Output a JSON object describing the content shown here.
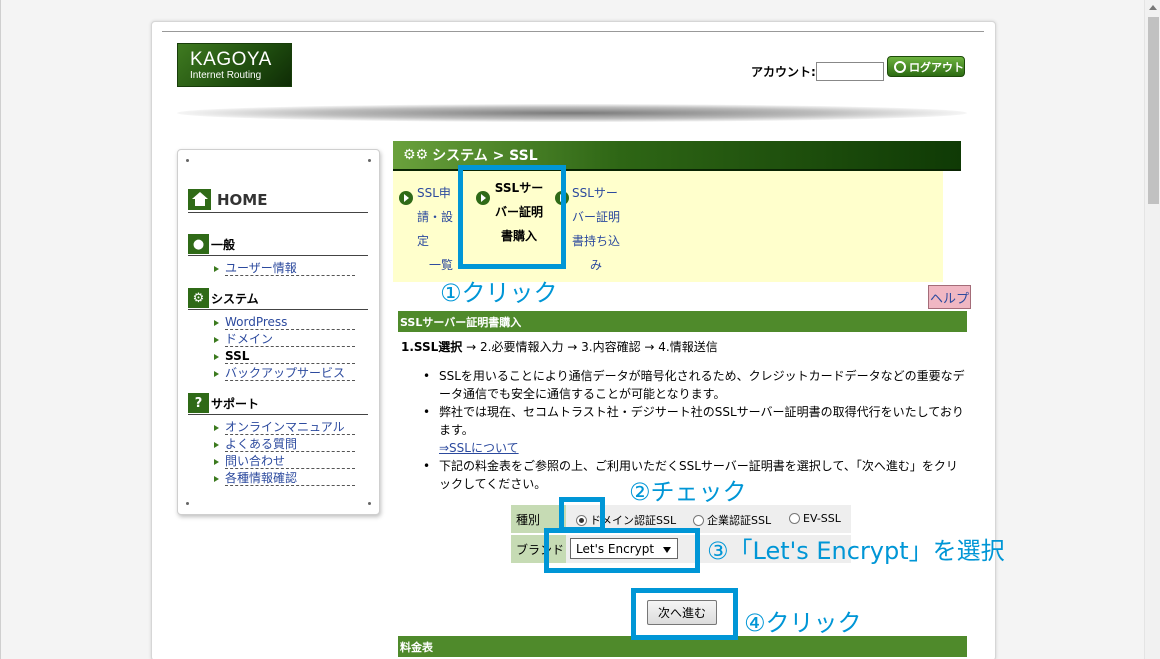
{
  "header": {
    "logo_main": "KAGOYA",
    "logo_sub": "Internet Routing",
    "account_label": "アカウント:",
    "account_value": "",
    "login_label": "ログアウト"
  },
  "sidebar": {
    "home_label": "HOME",
    "sections": [
      {
        "title": "一般",
        "icon": "user-icon",
        "items": [
          "ユーザー情報"
        ]
      },
      {
        "title": "システム",
        "icon": "gear-icon",
        "items": [
          "WordPress",
          "ドメイン",
          "SSL",
          "バックアップサービス"
        ]
      },
      {
        "title": "サポート",
        "icon": "question-icon",
        "items": [
          "オンラインマニュアル",
          "よくある質問",
          "問い合わせ",
          "各種情報確認"
        ]
      }
    ],
    "active_item": "SSL"
  },
  "main": {
    "title": "システム > SSL",
    "tabs": [
      {
        "lines": [
          "SSL申",
          "請・設定",
          "一覧"
        ]
      },
      {
        "lines": [
          "SSLサー",
          "バー証明",
          "書購入"
        ]
      },
      {
        "lines": [
          "SSLサー",
          "バー証明",
          "書持ち込",
          "み"
        ]
      }
    ],
    "help_label": "ヘルプ",
    "section_title": "SSLサーバー証明書購入",
    "steps": {
      "current": "1.SSL選択",
      "rest": " → 2.必要情報入力 → 3.内容確認 → 4.情報送信"
    },
    "bullets": {
      "b1": "SSLを用いることにより通信データが暗号化されるため、クレジットカードデータなどの重要なデータ通信でも安全に通信することが可能となります。",
      "b2": "弊社では現在、セコムトラスト社・デジサート社のSSLサーバー証明書の取得代行をいたしております。",
      "b2_link": "⇒SSLについて",
      "b3": "下記の料金表をご参照の上、ご利用いただくSSLサーバー証明書を選択して、「次へ進む」をクリックしてください。"
    },
    "form": {
      "type_label": "種別",
      "brand_label": "ブランド",
      "options": [
        "ドメイン認証SSL",
        "企業認証SSL",
        "EV-SSL"
      ],
      "selected_option": "ドメイン認証SSL",
      "brand_selected": "Let's Encrypt"
    },
    "next_label": "次へ進む",
    "price_title": "料金表"
  },
  "annotations": {
    "a1": "①クリック",
    "a2": "②チェック",
    "a3": "③「Let's Encrypt」を選択",
    "a4": "④クリック",
    "color": "#0096d6"
  }
}
